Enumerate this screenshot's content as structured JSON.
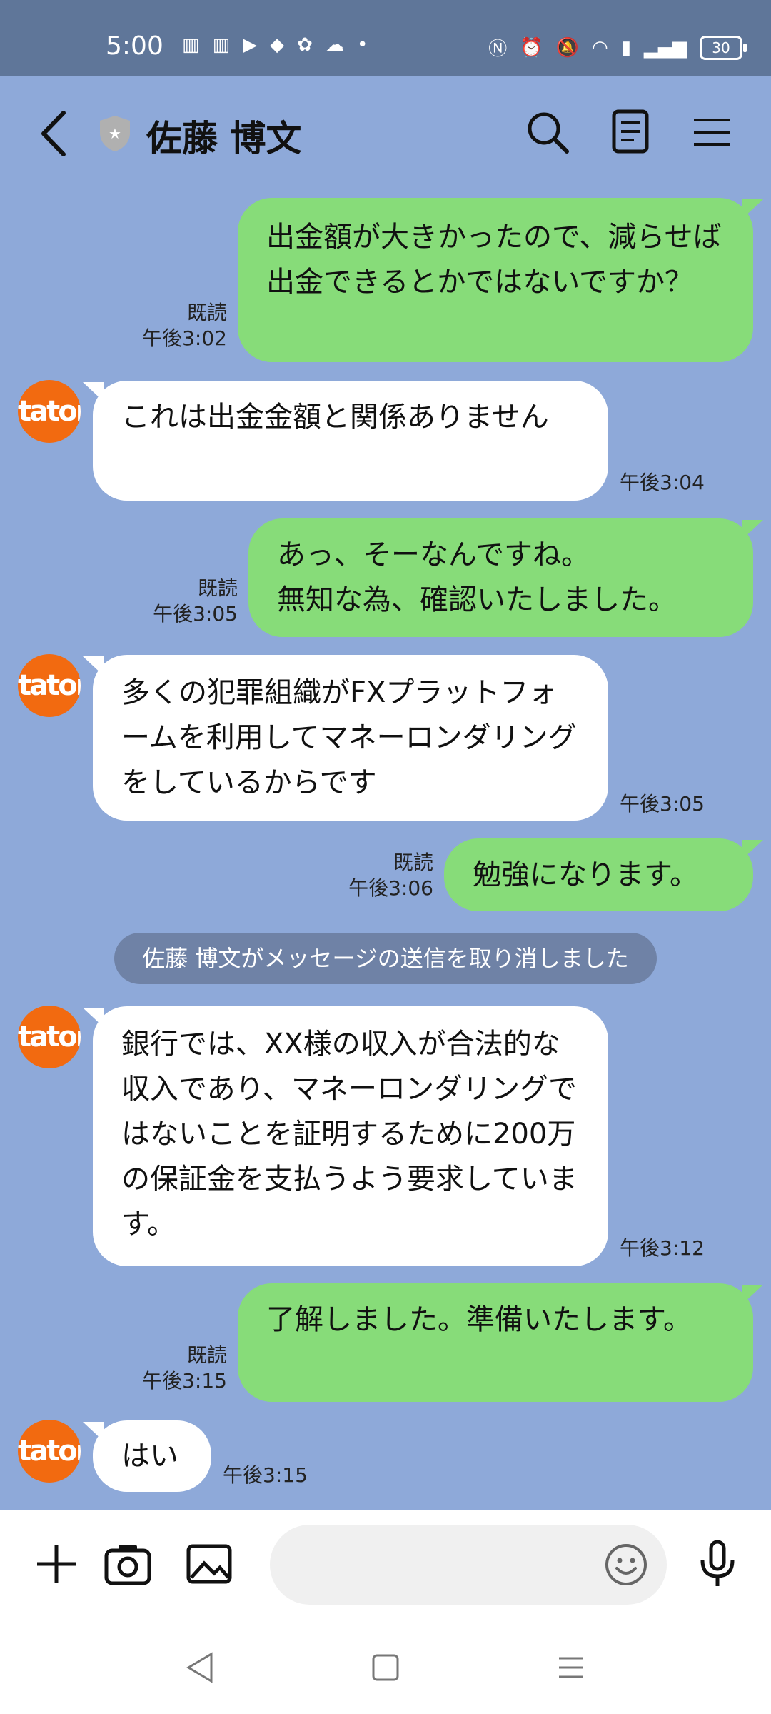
{
  "status_bar": {
    "time": "5:00",
    "left_icons": [
      "sim-icon",
      "sim-icon",
      "youtube-icon",
      "app-icon",
      "app-icon",
      "sheep-icon",
      "dot-icon"
    ],
    "right_icons": [
      "nfc-icon",
      "alarm-icon",
      "mute-icon",
      "wifi-icon",
      "volte-icon",
      "signal-icon"
    ],
    "battery": "30"
  },
  "header": {
    "title": "佐藤 博文"
  },
  "messages": [
    {
      "side": "out",
      "text": "出金額が大きかったので、減らせば出金できるとかではないですか？",
      "read": "既読",
      "time": "午後3:02"
    },
    {
      "side": "in",
      "text": "これは出金金額と関係ありません",
      "time": "午後3:04"
    },
    {
      "side": "out",
      "text": "あっ、そーなんですね。\n無知な為、確認いたしました。",
      "read": "既読",
      "time": "午後3:05"
    },
    {
      "side": "in",
      "text": "多くの犯罪組織がFXプラットフォームを利用してマネーロンダリングをしているからです",
      "time": "午後3:05"
    },
    {
      "side": "out",
      "text": "勉強になります。",
      "read": "既読",
      "time": "午後3:06"
    },
    {
      "side": "in",
      "text": "銀行では、XX様の収入が合法的な収入であり、マネーロンダリングではないことを証明するために200万の保証金を支払うよう要求しています。",
      "time": "午後3:12"
    },
    {
      "side": "out",
      "text": "了解しました。準備いたします。",
      "read": "既読",
      "time": "午後3:15"
    },
    {
      "side": "in",
      "text": "はい",
      "time": "午後3:15"
    }
  ],
  "notice": "佐藤 博文がメッセージの送信を取り消しました",
  "avatar_text": "taton",
  "input": {
    "placeholder": ""
  },
  "colors": {
    "background": "#8ea9d9",
    "outgoing_bubble": "#87dc79",
    "incoming_bubble": "#ffffff",
    "avatar": "#f26a10"
  }
}
